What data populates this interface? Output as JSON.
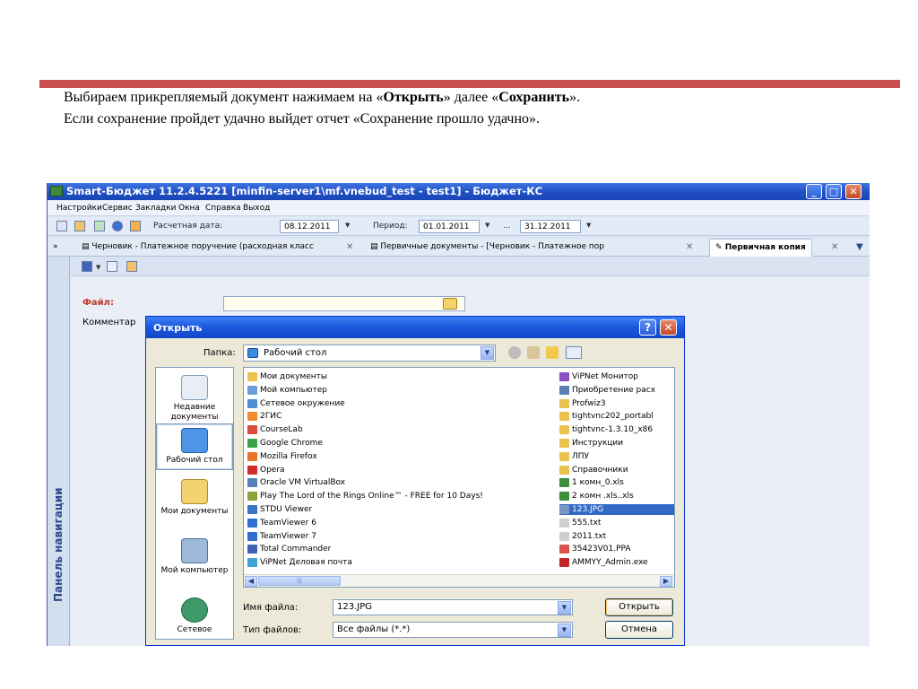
{
  "instructions": {
    "line1_a": "Выбираем прикрепляемый документ нажимаем на «",
    "line1_b": "Открыть",
    "line1_c": "» далее «",
    "line1_d": "Сохранить",
    "line1_e": "».",
    "line2": "Если сохранение пройдет удачно выйдет отчет «Сохранение прошло удачно»."
  },
  "app": {
    "title": "Smart-Бюджет 11.2.4.5221 [minfin-server1\\mf.vnebud_test - test1] - Бюджет-КС",
    "menu": [
      "Настройки",
      "Сервис",
      "Закладки",
      "Окна",
      "Справка",
      "Выход"
    ],
    "toolbar": {
      "calc_date_label": "Расчетная дата:",
      "calc_date": "08.12.2011",
      "period_label": "Период:",
      "period_from": "01.01.2011",
      "period_sep": "...",
      "period_to": "31.12.2011"
    },
    "tabs": [
      {
        "label": "Черновик - Платежное поручение (расходная класс"
      },
      {
        "label": "Первичные документы - [Черновик - Платежное пор"
      },
      {
        "label": "Первичная копия"
      }
    ],
    "nav_panel": "Панель навигации",
    "form": {
      "file_label": "Файл:",
      "comment_label": "Комментар"
    }
  },
  "dialog": {
    "title": "Открыть",
    "help": "?",
    "close": "✕",
    "lookin_label": "Папка:",
    "lookin_value": "Рабочий стол",
    "places": [
      "Недавние документы",
      "Рабочий стол",
      "Мои документы",
      "Мой компьютер",
      "Сетевое"
    ],
    "files_left": [
      {
        "name": "Мои документы",
        "color": "#e9c34e"
      },
      {
        "name": "Мой компьютер",
        "color": "#6aa0d8"
      },
      {
        "name": "Сетевое окружение",
        "color": "#4d8fd6"
      },
      {
        "name": "2ГИС",
        "color": "#f08a2c"
      },
      {
        "name": "CourseLab",
        "color": "#d94b3a"
      },
      {
        "name": "Google Chrome",
        "color": "#3aa34a"
      },
      {
        "name": "Mozilla Firefox",
        "color": "#e8742a"
      },
      {
        "name": "Opera",
        "color": "#d12c2c"
      },
      {
        "name": "Oracle VM VirtualBox",
        "color": "#5b7fb8"
      },
      {
        "name": "Play The Lord of the Rings Online™ - FREE for 10 Days!",
        "color": "#8aa53a"
      },
      {
        "name": "STDU Viewer",
        "color": "#3a74c2"
      },
      {
        "name": "TeamViewer 6",
        "color": "#2f6fd0"
      },
      {
        "name": "TeamViewer 7",
        "color": "#2f6fd0"
      },
      {
        "name": "Total Commander",
        "color": "#3c63b3"
      },
      {
        "name": "ViPNet Деловая почта",
        "color": "#3fa3d6"
      }
    ],
    "files_right": [
      {
        "name": "ViPNet Монитор",
        "color": "#8a4fc2",
        "selected": false
      },
      {
        "name": "Приобретение расх",
        "color": "#5a7fb0",
        "selected": false
      },
      {
        "name": "Profwiz3",
        "color": "#e9c34e",
        "selected": false
      },
      {
        "name": "tightvnc202_portabl",
        "color": "#e9c34e",
        "selected": false
      },
      {
        "name": "tightvnc-1.3.10_x86",
        "color": "#e9c34e",
        "selected": false
      },
      {
        "name": "Инструкции",
        "color": "#e9c34e",
        "selected": false
      },
      {
        "name": "ЛПУ",
        "color": "#e9c34e",
        "selected": false
      },
      {
        "name": "Справочники",
        "color": "#e9c34e",
        "selected": false
      },
      {
        "name": "1 комн_0.xls",
        "color": "#3d8f3d",
        "selected": false
      },
      {
        "name": "2 комн .xls..xls",
        "color": "#3d8f3d",
        "selected": false
      },
      {
        "name": "123.JPG",
        "color": "#7a96c8",
        "selected": true
      },
      {
        "name": "555.txt",
        "color": "#cfcfcf",
        "selected": false
      },
      {
        "name": "2011.txt",
        "color": "#cfcfcf",
        "selected": false
      },
      {
        "name": "35423V01.PPA",
        "color": "#d9534f",
        "selected": false
      },
      {
        "name": "AMMYY_Admin.exe",
        "color": "#c12727",
        "selected": false
      }
    ],
    "filename_label": "Имя файла:",
    "filename_value": "123.JPG",
    "filetype_label": "Тип файлов:",
    "filetype_value": "Все файлы (*.*)",
    "open_button": "Открыть",
    "cancel_button": "Отмена"
  },
  "colors": {
    "slide_bar": "#c9504f",
    "title_bar": "#1f4fc4",
    "selection": "#316ac5"
  }
}
